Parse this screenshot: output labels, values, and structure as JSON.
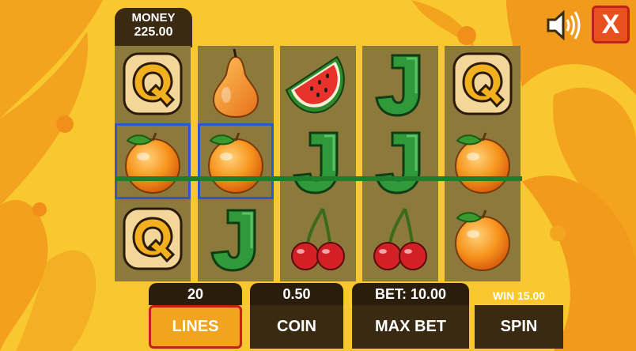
{
  "money": {
    "label": "MONEY",
    "value": "225.00"
  },
  "close_label": "X",
  "reels": [
    [
      "letter-q-symbol",
      "orange-symbol",
      "letter-q-symbol"
    ],
    [
      "pear-symbol",
      "orange-symbol",
      "letter-j-symbol"
    ],
    [
      "watermelon-symbol",
      "letter-j-symbol",
      "cherry-symbol"
    ],
    [
      "letter-j-symbol",
      "letter-j-symbol",
      "cherry-symbol"
    ],
    [
      "letter-q-symbol",
      "orange-symbol",
      "orange-symbol"
    ]
  ],
  "controls": {
    "lines_value": "20",
    "coin_value": "0.50",
    "bet_value": "BET: 10.00",
    "win_value": "WIN 15.00",
    "lines_label": "LINES",
    "coin_label": "COIN",
    "max_bet_label": "MAX BET",
    "spin_label": "SPIN"
  },
  "colors": {
    "accent": "#f2a41f",
    "payline": "#1f7d2c",
    "highlight": "#2a58c9",
    "button_dark": "#3b2a12"
  }
}
